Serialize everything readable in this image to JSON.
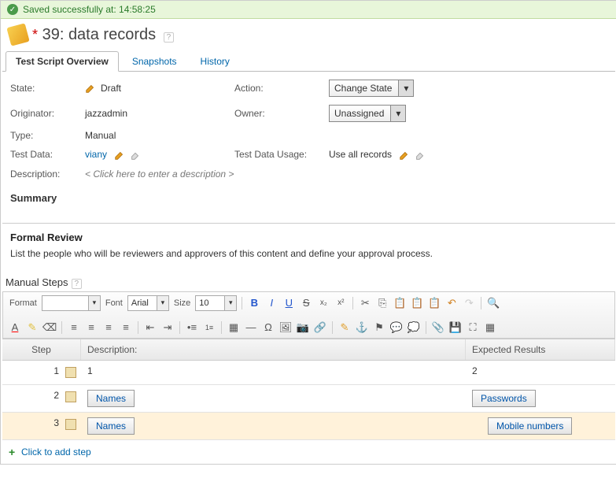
{
  "notification": {
    "text": "Saved successfully at: 14:58:25"
  },
  "header": {
    "title": "39: data records",
    "star": "*"
  },
  "tabs": {
    "overview": "Test Script Overview",
    "snapshots": "Snapshots",
    "history": "History"
  },
  "form": {
    "state_label": "State:",
    "state_value": "Draft",
    "action_label": "Action:",
    "action_value": "Change State",
    "originator_label": "Originator:",
    "originator_value": "jazzadmin",
    "owner_label": "Owner:",
    "owner_value": "Unassigned",
    "type_label": "Type:",
    "type_value": "Manual",
    "testdata_label": "Test Data:",
    "testdata_value": "viany",
    "usage_label": "Test Data Usage:",
    "usage_value": "Use all records",
    "desc_label": "Description:",
    "desc_placeholder": "< Click here to enter a description >"
  },
  "summary": {
    "title": "Summary"
  },
  "review": {
    "title": "Formal Review",
    "text": "List the people who will be reviewers and approvers of this content and define your approval process."
  },
  "manual": {
    "title": "Manual Steps"
  },
  "toolbar": {
    "format": "Format",
    "font": "Font",
    "font_val": "Arial",
    "size": "Size",
    "size_val": "10"
  },
  "columns": {
    "step": "Step",
    "desc": "Description:",
    "expected": "Expected Results"
  },
  "rows": [
    {
      "num": "1",
      "desc": "1",
      "expected": "2"
    },
    {
      "num": "2",
      "desc_chip": "Names",
      "expected_chip": "Passwords"
    },
    {
      "num": "3",
      "desc_chip": "Names",
      "expected_chip": "Mobile numbers"
    }
  ],
  "addstep": "Click to add step"
}
